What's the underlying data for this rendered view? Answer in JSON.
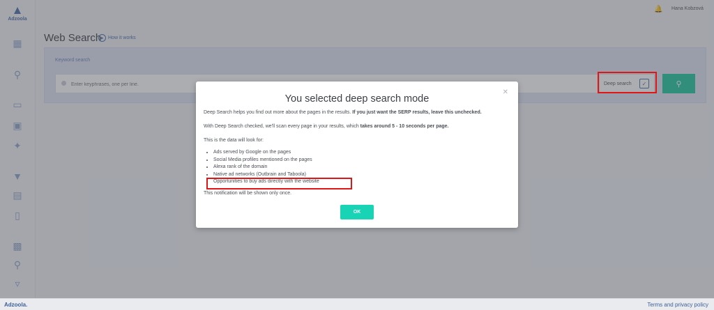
{
  "app": {
    "logo_text": "Adzoola"
  },
  "header": {
    "user_name": "Hana Kobzová"
  },
  "page": {
    "title": "Web Search",
    "how_it_works": "How it works"
  },
  "search": {
    "label": "Keyword search",
    "placeholder": "Enter keyphrases, one per line.",
    "deep_label": "Deep search",
    "deep_checked": true
  },
  "modal": {
    "title": "You selected deep search mode",
    "p1_text": "Deep Search helps you find out more about the pages in the results. ",
    "p1_bold": "If you just want the SERP results, leave this unchecked.",
    "p2_text": "With Deep Search checked, we'll scan every page in your results, which ",
    "p2_bold": "takes around 5 - 10 seconds per page.",
    "p3": "This is the data will look for:",
    "items": [
      "Ads served by Google on the pages",
      "Social Media profiles mentioned on the pages",
      "Alexa rank of the domain",
      "Native ad networks (Outbrain and Taboola)",
      "Opportunities to buy ads directly with the website"
    ],
    "p4": "This notification will be shown only once.",
    "ok_label": "OK"
  },
  "footer": {
    "logo": "Adzoola.",
    "link": "Terms and privacy policy"
  },
  "colors": {
    "accent": "#19d4b4",
    "brand": "#4a6fa8",
    "highlight": "#e01515"
  },
  "icons": [
    "dashboard-icon",
    "search-icon",
    "monitor-icon",
    "layers-icon",
    "magic-icon",
    "funnel-icon",
    "list-icon",
    "mobile-icon",
    "hierarchy-icon",
    "zoom-icon",
    "filter-icon",
    "bell-icon",
    "play-icon",
    "close-icon",
    "check-icon"
  ]
}
